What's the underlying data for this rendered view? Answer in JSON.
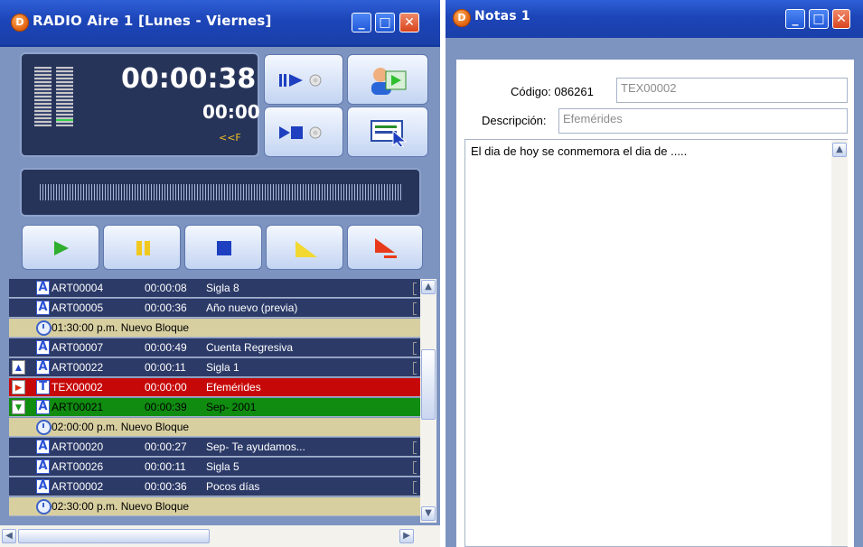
{
  "radio_window": {
    "title": "RADIO Aire 1 [Lunes - Viernes]",
    "icon_letter": "D",
    "clock_main": "00:00:38",
    "clock_sub": "00:00",
    "indicator": "<<F",
    "playlist": [
      {
        "kind": "item",
        "style": "dark",
        "arrow": "",
        "type": "A",
        "code": "ART00004",
        "duration": "00:00:08",
        "title": "Sigla 8"
      },
      {
        "kind": "item",
        "style": "dark",
        "arrow": "",
        "type": "A",
        "code": "ART00005",
        "duration": "00:00:36",
        "title": "Año nuevo (previa)"
      },
      {
        "kind": "block",
        "style": "block",
        "text": "01:30:00 p.m. Nuevo Bloque"
      },
      {
        "kind": "item",
        "style": "dark",
        "arrow": "",
        "type": "A",
        "code": "ART00007",
        "duration": "00:00:49",
        "title": "Cuenta Regresiva"
      },
      {
        "kind": "item",
        "style": "dark",
        "arrow": "up",
        "type": "A",
        "code": "ART00022",
        "duration": "00:00:11",
        "title": "Sigla 1"
      },
      {
        "kind": "item",
        "style": "red",
        "arrow": "right",
        "type": "T",
        "code": "TEX00002",
        "duration": "00:00:00",
        "title": "Efemérides"
      },
      {
        "kind": "item",
        "style": "green",
        "arrow": "down",
        "type": "A",
        "code": "ART00021",
        "duration": "00:00:39",
        "title": "Sep- 2001"
      },
      {
        "kind": "block",
        "style": "block",
        "text": "02:00:00 p.m. Nuevo Bloque"
      },
      {
        "kind": "item",
        "style": "dark",
        "arrow": "",
        "type": "A",
        "code": "ART00020",
        "duration": "00:00:27",
        "title": "Sep- Te ayudamos..."
      },
      {
        "kind": "item",
        "style": "dark",
        "arrow": "",
        "type": "A",
        "code": "ART00026",
        "duration": "00:00:11",
        "title": "Sigla 5"
      },
      {
        "kind": "item",
        "style": "dark",
        "arrow": "",
        "type": "A",
        "code": "ART00002",
        "duration": "00:00:36",
        "title": "Pocos días"
      },
      {
        "kind": "block",
        "style": "block",
        "text": "02:30:00 p.m. Nuevo Bloque"
      }
    ]
  },
  "notas_window": {
    "title": "Notas 1",
    "icon_letter": "D",
    "codigo_label": "Código: 086261",
    "codigo_value": "TEX00002",
    "descripcion_label": "Descripción:",
    "descripcion_value": "Efemérides",
    "memo_text": "El dia de hoy se conmemora el dia de ....."
  },
  "colors": {
    "title_blue": "#1c45b8",
    "frame": "#7d94c1",
    "row_dark": "#2c3a68",
    "row_red": "#c70808",
    "row_green": "#108c10",
    "row_block": "#d8cfa1"
  },
  "icons": {
    "window_controls": [
      "minimize-icon",
      "maximize-icon",
      "close-icon"
    ],
    "transport": [
      "play-icon",
      "pause-icon",
      "stop-icon",
      "fade-icon",
      "fade-stop-icon"
    ]
  }
}
